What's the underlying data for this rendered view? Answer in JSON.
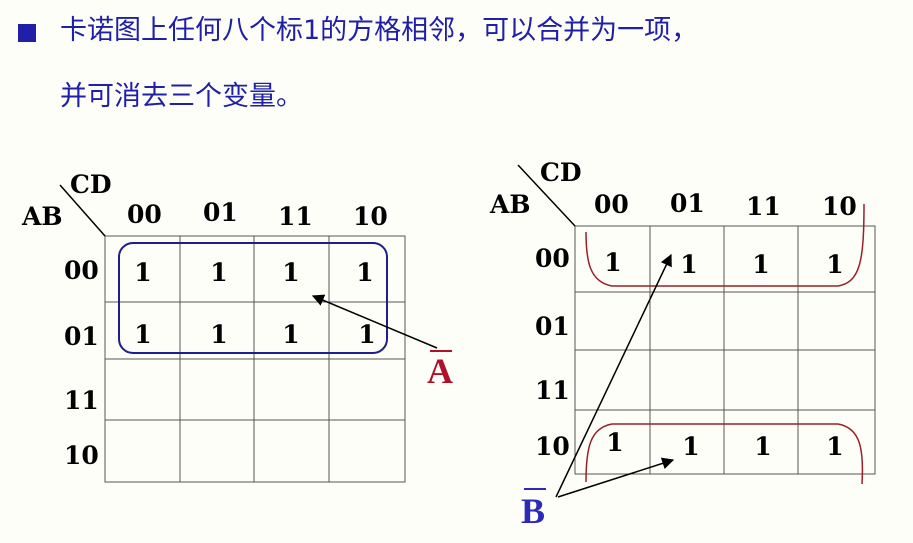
{
  "heading": {
    "bullet_icon": "square-bullet-icon",
    "line1": "卡诺图上任何八个标1的方格相邻，可以合并为一项，",
    "line2": "并可消去三个变量。"
  },
  "left_map": {
    "var_row": "AB",
    "var_col": "CD",
    "col_headers": [
      "00",
      "01",
      "11",
      "10"
    ],
    "row_headers": [
      "00",
      "01",
      "11",
      "10"
    ],
    "cells": [
      [
        "1",
        "1",
        "1",
        "1"
      ],
      [
        "1",
        "1",
        "1",
        "1"
      ],
      [
        "",
        "",
        "",
        ""
      ],
      [
        "",
        "",
        "",
        ""
      ]
    ],
    "group_label": "A",
    "group_label_overbar": true,
    "group_color": "#1f1f8a",
    "label_color": "#b0102a"
  },
  "right_map": {
    "var_row": "AB",
    "var_col": "CD",
    "col_headers": [
      "00",
      "01",
      "11",
      "10"
    ],
    "row_headers": [
      "00",
      "01",
      "11",
      "10"
    ],
    "cells": [
      [
        "1",
        "1",
        "1",
        "1"
      ],
      [
        "",
        "",
        "",
        ""
      ],
      [
        "",
        "",
        "",
        ""
      ],
      [
        "1",
        "1",
        "1",
        "1"
      ]
    ],
    "group_label": "B",
    "group_label_overbar": true,
    "group_color": "#9a1f2a",
    "label_color": "#2b2bb8"
  }
}
